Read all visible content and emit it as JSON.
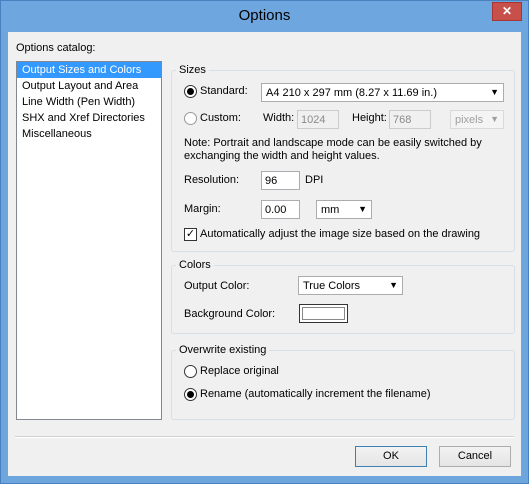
{
  "window": {
    "title": "Options",
    "close_glyph": "✕"
  },
  "catalog": {
    "label": "Options catalog:",
    "items": [
      {
        "label": "Output Sizes and Colors",
        "selected": true
      },
      {
        "label": "Output Layout and Area",
        "selected": false
      },
      {
        "label": "Line Width (Pen Width)",
        "selected": false
      },
      {
        "label": "SHX and Xref Directories",
        "selected": false
      },
      {
        "label": "Miscellaneous",
        "selected": false
      }
    ]
  },
  "sizes": {
    "title": "Sizes",
    "standard_label": "Standard:",
    "standard_value": "A4 210 x 297 mm (8.27 x 11.69 in.)",
    "custom_label": "Custom:",
    "width_label": "Width:",
    "width_value": "1024",
    "height_label": "Height:",
    "height_value": "768",
    "units_value": "pixels",
    "note": "Note: Portrait and landscape mode can be easily switched by exchanging the width and height values.",
    "resolution_label": "Resolution:",
    "resolution_value": "96",
    "resolution_unit": "DPI",
    "margin_label": "Margin:",
    "margin_value": "0.00",
    "margin_unit": "mm",
    "auto_adjust_label": "Automatically adjust the image size based on the drawing",
    "auto_adjust_checked": true
  },
  "colors": {
    "title": "Colors",
    "output_label": "Output Color:",
    "output_value": "True Colors",
    "background_label": "Background Color:",
    "background_color": "#ffffff"
  },
  "overwrite": {
    "title": "Overwrite existing",
    "replace_label": "Replace original",
    "rename_label": "Rename (automatically increment the filename)",
    "selected": "rename"
  },
  "buttons": {
    "ok": "OK",
    "cancel": "Cancel"
  },
  "icons": {
    "dropdown": "▼",
    "check": "✓"
  }
}
